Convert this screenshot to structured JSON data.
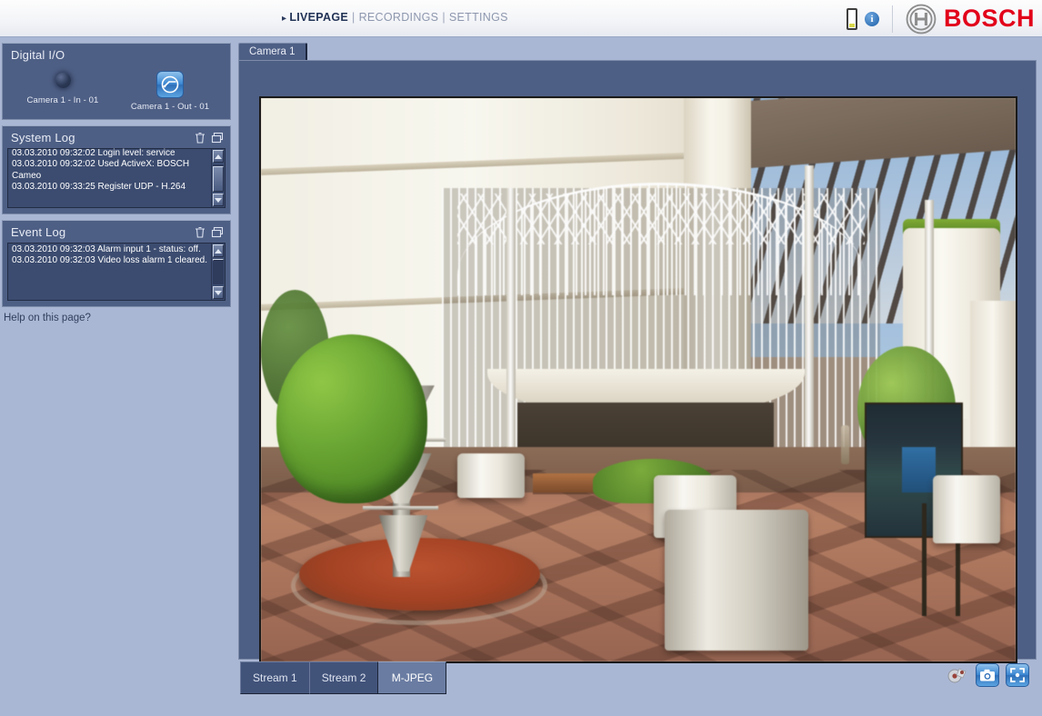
{
  "header": {
    "nav": {
      "arrow": "▸",
      "livepage": "LIVEPAGE",
      "sep1": "|",
      "recordings": "RECORDINGS",
      "sep2": "|",
      "settings": "SETTINGS"
    },
    "info_glyph": "i",
    "brand": "BOSCH",
    "icons": {
      "battery": "battery-icon",
      "info": "info-icon",
      "logo_mark": "bosch-emblem-icon"
    },
    "colors": {
      "brand_red": "#e2001a",
      "nav_active": "#223356",
      "nav_inactive": "#8d97ae"
    }
  },
  "sidebar": {
    "digital_io": {
      "title": "Digital I/O",
      "input": {
        "label": "Camera 1 - In - 01",
        "state": "off"
      },
      "output": {
        "label": "Camera 1 - Out - 01",
        "state": "on"
      }
    },
    "system_log": {
      "title": "System Log",
      "delete_icon": "trash-icon",
      "window_icon": "new-window-icon",
      "entries": "03.03.2010 09:32:02 Login level: service\n03.03.2010 09:32:02 Used ActiveX: BOSCH Cameo\n03.03.2010 09:33:25 Register UDP - H.264"
    },
    "event_log": {
      "title": "Event Log",
      "delete_icon": "trash-icon",
      "window_icon": "new-window-icon",
      "entries": "03.03.2010 09:32:03 Alarm input 1 - status: off.\n03.03.2010 09:32:03 Video loss alarm 1 cleared."
    },
    "help_link": "Help on this page?"
  },
  "main": {
    "camera_tab": "Camera 1",
    "stream_tabs": [
      {
        "label": "Stream 1",
        "active": false
      },
      {
        "label": "Stream 2",
        "active": false
      },
      {
        "label": "M-JPEG",
        "active": true
      }
    ],
    "video_tools": [
      {
        "name": "recording-indicator-icon",
        "enabled": false
      },
      {
        "name": "snapshot-icon",
        "enabled": true
      },
      {
        "name": "fullscreen-icon",
        "enabled": true
      }
    ]
  },
  "colors": {
    "page_background": "#aab7d4",
    "panel_background": "#4e5f85",
    "panel_border": "#7d8cab",
    "log_background": "#3c4c70",
    "tab_active": "#6a7ca2"
  }
}
